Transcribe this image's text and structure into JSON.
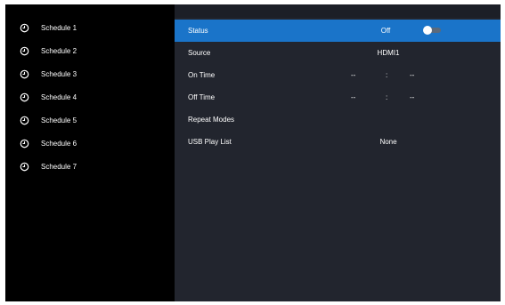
{
  "sidebar": {
    "items": [
      {
        "label": "Schedule 1",
        "icon": "clock-icon"
      },
      {
        "label": "Schedule 2",
        "icon": "clock-icon"
      },
      {
        "label": "Schedule 3",
        "icon": "clock-icon"
      },
      {
        "label": "Schedule 4",
        "icon": "clock-icon"
      },
      {
        "label": "Schedule 5",
        "icon": "clock-icon"
      },
      {
        "label": "Schedule 6",
        "icon": "clock-icon"
      },
      {
        "label": "Schedule 7",
        "icon": "clock-icon"
      }
    ]
  },
  "settings": {
    "status": {
      "label": "Status",
      "value": "Off",
      "toggle_on": false
    },
    "source": {
      "label": "Source",
      "value": "HDMI1"
    },
    "on_time": {
      "label": "On Time",
      "hour": "--",
      "separator": ":",
      "minute": "--"
    },
    "off_time": {
      "label": "Off Time",
      "hour": "--",
      "separator": ":",
      "minute": "--"
    },
    "repeat_modes": {
      "label": "Repeat Modes"
    },
    "usb_play_list": {
      "label": "USB Play List",
      "value": "None"
    }
  },
  "colors": {
    "highlight": "#1a74c9",
    "panel_background": "#22252e",
    "sidebar_background": "#000000",
    "text": "#ffffff"
  }
}
